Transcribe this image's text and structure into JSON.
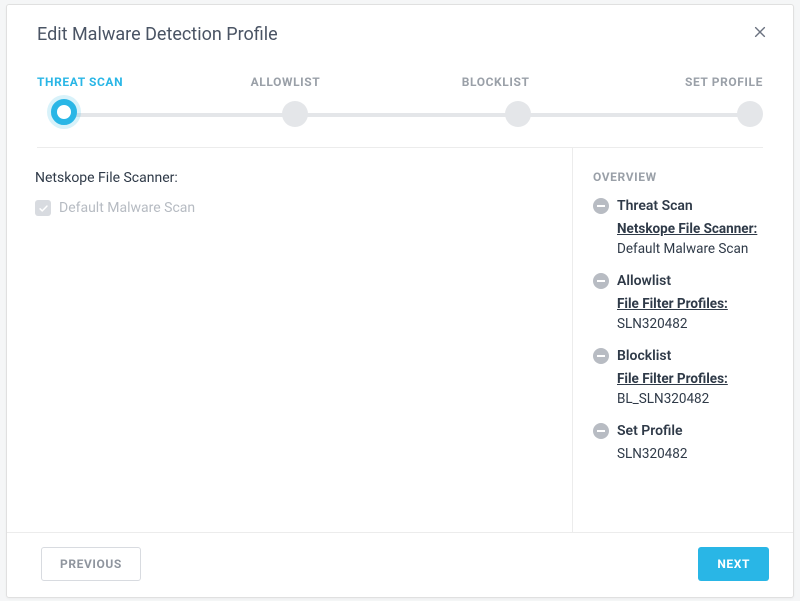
{
  "header": {
    "title": "Edit Malware Detection Profile"
  },
  "steps": {
    "labels": [
      "THREAT SCAN",
      "ALLOWLIST",
      "BLOCKLIST",
      "SET PROFILE"
    ],
    "activeIndex": 0
  },
  "threatScan": {
    "sectionTitle": "Netskope File Scanner:",
    "checkbox": {
      "label": "Default Malware Scan",
      "checked": true,
      "disabled": true
    }
  },
  "overview": {
    "title": "OVERVIEW",
    "items": [
      {
        "title": "Threat Scan",
        "subLabel": "Netskope File Scanner:",
        "subValue": "Default Malware Scan"
      },
      {
        "title": "Allowlist",
        "subLabel": "File Filter Profiles:",
        "subValue": "SLN320482"
      },
      {
        "title": "Blocklist",
        "subLabel": "File Filter Profiles:",
        "subValue": "BL_SLN320482"
      },
      {
        "title": "Set Profile",
        "subLabel": "",
        "subValue": "SLN320482"
      }
    ]
  },
  "footer": {
    "previous": "PREVIOUS",
    "next": "NEXT"
  }
}
